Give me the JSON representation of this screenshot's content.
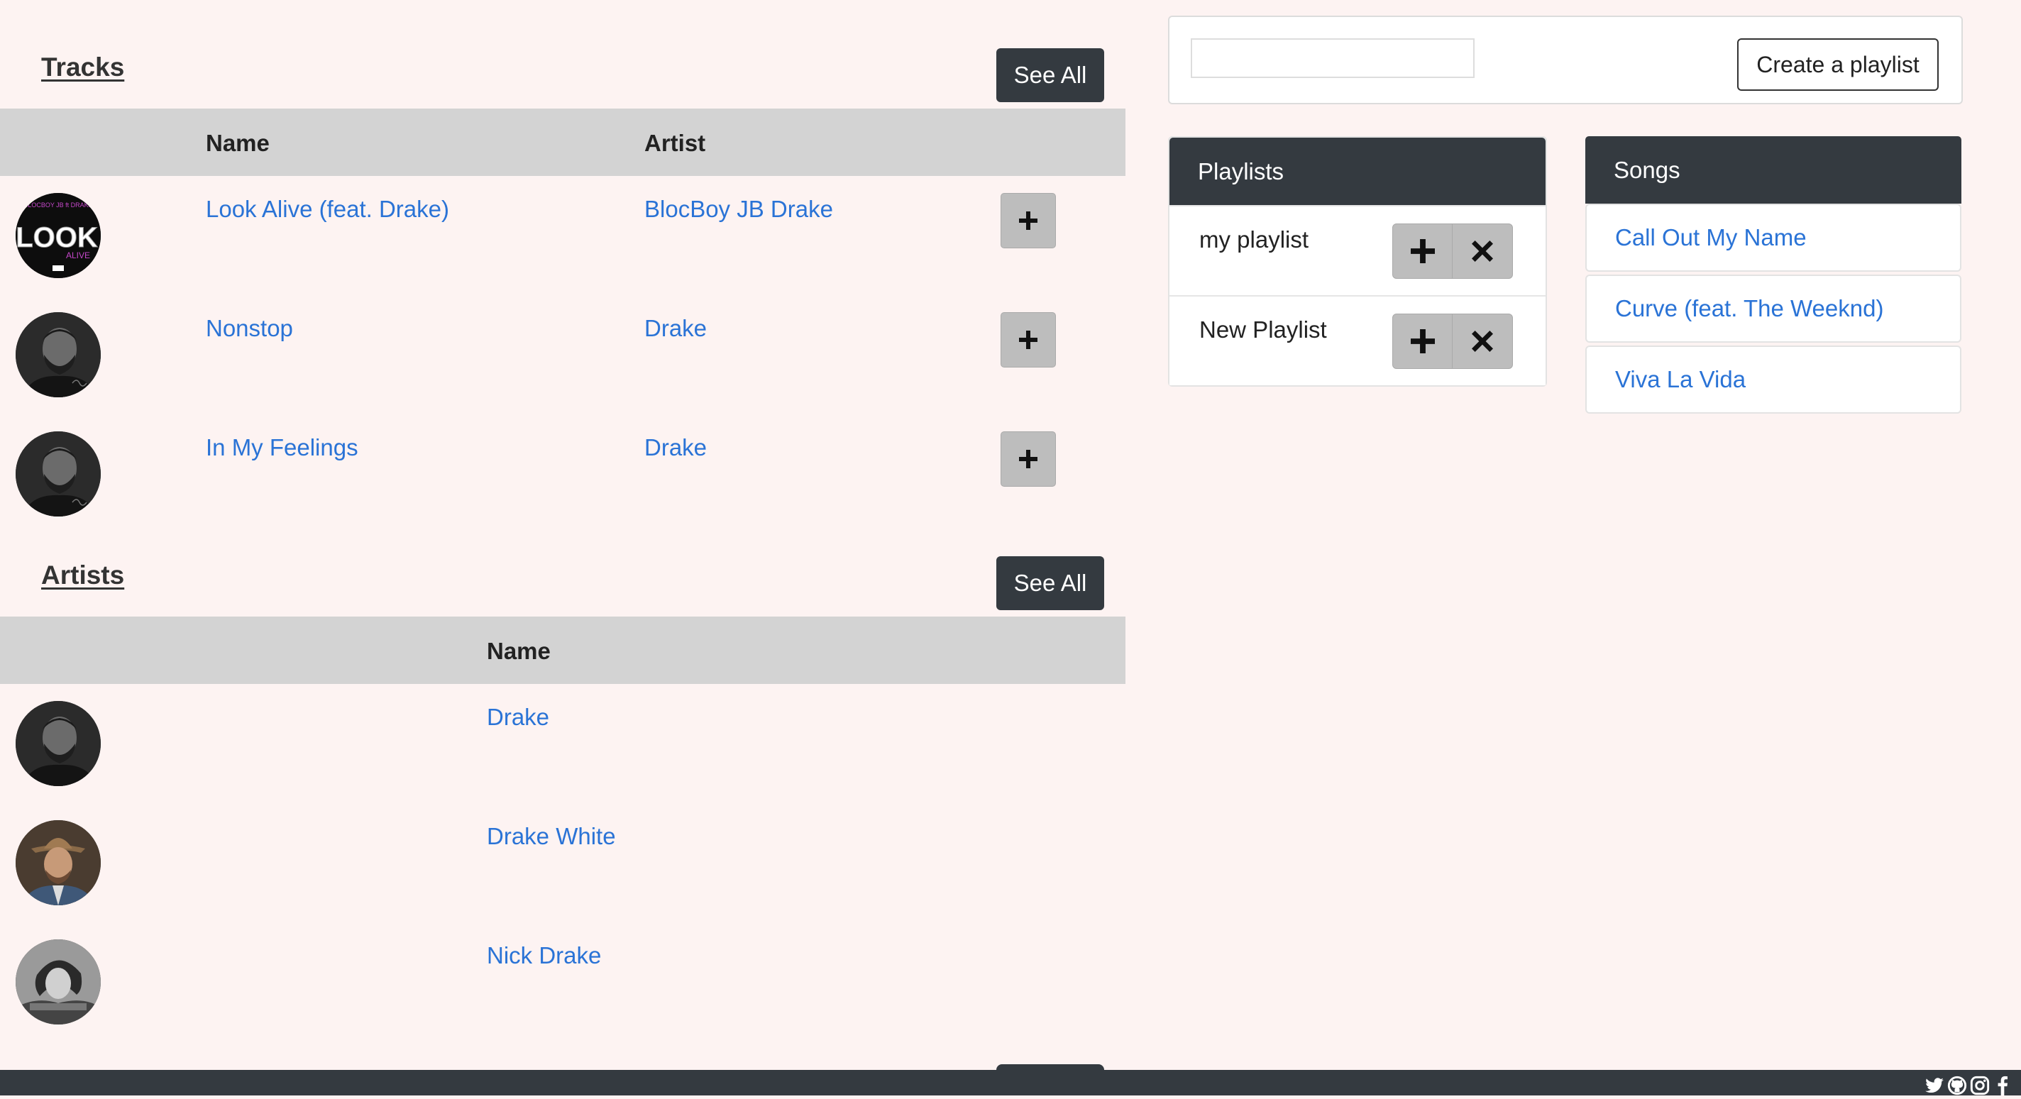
{
  "tracks": {
    "title": "Tracks",
    "see_all": "See All",
    "headers": {
      "name": "Name",
      "artist": "Artist"
    },
    "rows": [
      {
        "name": "Look Alive (feat. Drake)",
        "artist": "BlocBoy JB Drake",
        "cover": "look-alive-cover"
      },
      {
        "name": "Nonstop",
        "artist": "Drake",
        "cover": "drake-portrait"
      },
      {
        "name": "In My Feelings",
        "artist": "Drake",
        "cover": "drake-portrait"
      }
    ],
    "add_icon": "plus-icon"
  },
  "artists": {
    "title": "Artists",
    "see_all": "See All",
    "headers": {
      "name": "Name"
    },
    "rows": [
      {
        "name": "Drake",
        "photo": "drake-portrait"
      },
      {
        "name": "Drake White",
        "photo": "drake-white-portrait"
      },
      {
        "name": "Nick Drake",
        "photo": "nick-drake-portrait"
      }
    ]
  },
  "create_playlist": {
    "input_value": "",
    "button_label": "Create a playlist"
  },
  "playlists": {
    "title": "Playlists",
    "items": [
      {
        "name": "my playlist"
      },
      {
        "name": "New Playlist"
      }
    ],
    "add_icon": "plus-icon",
    "delete_icon": "close-icon"
  },
  "songs": {
    "title": "Songs",
    "items": [
      {
        "name": "Call Out My Name"
      },
      {
        "name": "Curve (feat. The Weeknd)"
      },
      {
        "name": "Viva La Vida"
      }
    ]
  },
  "footer": {
    "social_icons": [
      "twitter-icon",
      "github-icon",
      "instagram-icon",
      "facebook-icon"
    ]
  },
  "colors": {
    "background": "#fdf3f2",
    "dark": "#343a40",
    "link": "#2a73d6",
    "table_header": "#d3d3d3",
    "button_gray": "#bdbdbd"
  }
}
